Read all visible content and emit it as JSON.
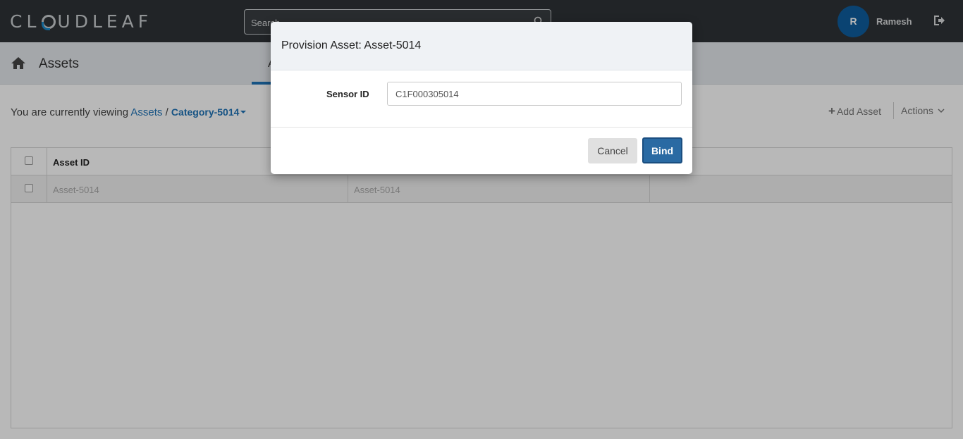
{
  "header": {
    "logo_prefix": "CL",
    "logo_suffix": "UDLEAF",
    "search_placeholder": "Search",
    "user_initial": "R",
    "user_name": "Ramesh"
  },
  "subheader": {
    "title": "Assets",
    "active_tab_partial": "A"
  },
  "breadcrumb": {
    "prefix": "You are currently viewing",
    "root": "Assets",
    "separator": "/",
    "category": "Category-5014"
  },
  "toolbar": {
    "add_asset_label": "Add Asset",
    "actions_label": "Actions"
  },
  "table": {
    "columns": [
      "Asset ID"
    ],
    "rows": [
      [
        "Asset-5014",
        "Asset-5014",
        ""
      ]
    ]
  },
  "modal": {
    "title": "Provision Asset: Asset-5014",
    "sensor_label": "Sensor ID",
    "sensor_value": "C1F000305014",
    "cancel_label": "Cancel",
    "bind_label": "Bind"
  },
  "colors": {
    "topbar": "#2f3336",
    "accent": "#1f73b7",
    "primary_button": "#2a6aa3",
    "avatar": "#0f5e9e"
  }
}
